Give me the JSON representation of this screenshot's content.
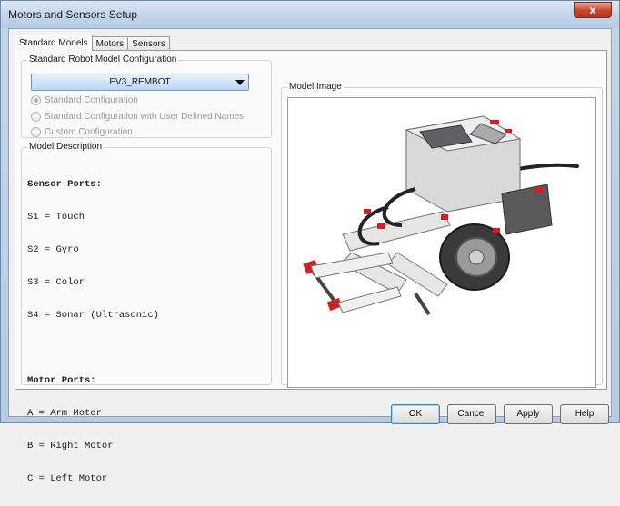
{
  "window": {
    "title": "Motors and Sensors Setup",
    "close_label": "x"
  },
  "tabs": [
    {
      "label": "Standard Models",
      "active": true
    },
    {
      "label": "Motors",
      "active": false
    },
    {
      "label": "Sensors",
      "active": false
    }
  ],
  "config_group": {
    "legend": "Standard Robot Model Configuration",
    "selected_model": "EV3_REMBOT",
    "options": [
      {
        "label": "Standard Configuration",
        "checked": true
      },
      {
        "label": "Standard Configuration with User Defined Names",
        "checked": false
      },
      {
        "label": "Custom Configuration",
        "checked": false
      }
    ]
  },
  "description_group": {
    "legend": "Model Description",
    "sensor_header": "Sensor Ports:",
    "sensor_lines": [
      "S1 = Touch",
      "S2 = Gyro",
      "S3 = Color",
      "S4 = Sonar (Ultrasonic)"
    ],
    "motor_header": "Motor Ports:",
    "motor_lines": [
      "A = Arm Motor",
      "B = Right Motor",
      "C = Left Motor"
    ]
  },
  "image_group": {
    "legend": "Model Image"
  },
  "buttons": {
    "ok": "OK",
    "cancel": "Cancel",
    "apply": "Apply",
    "help": "Help"
  }
}
